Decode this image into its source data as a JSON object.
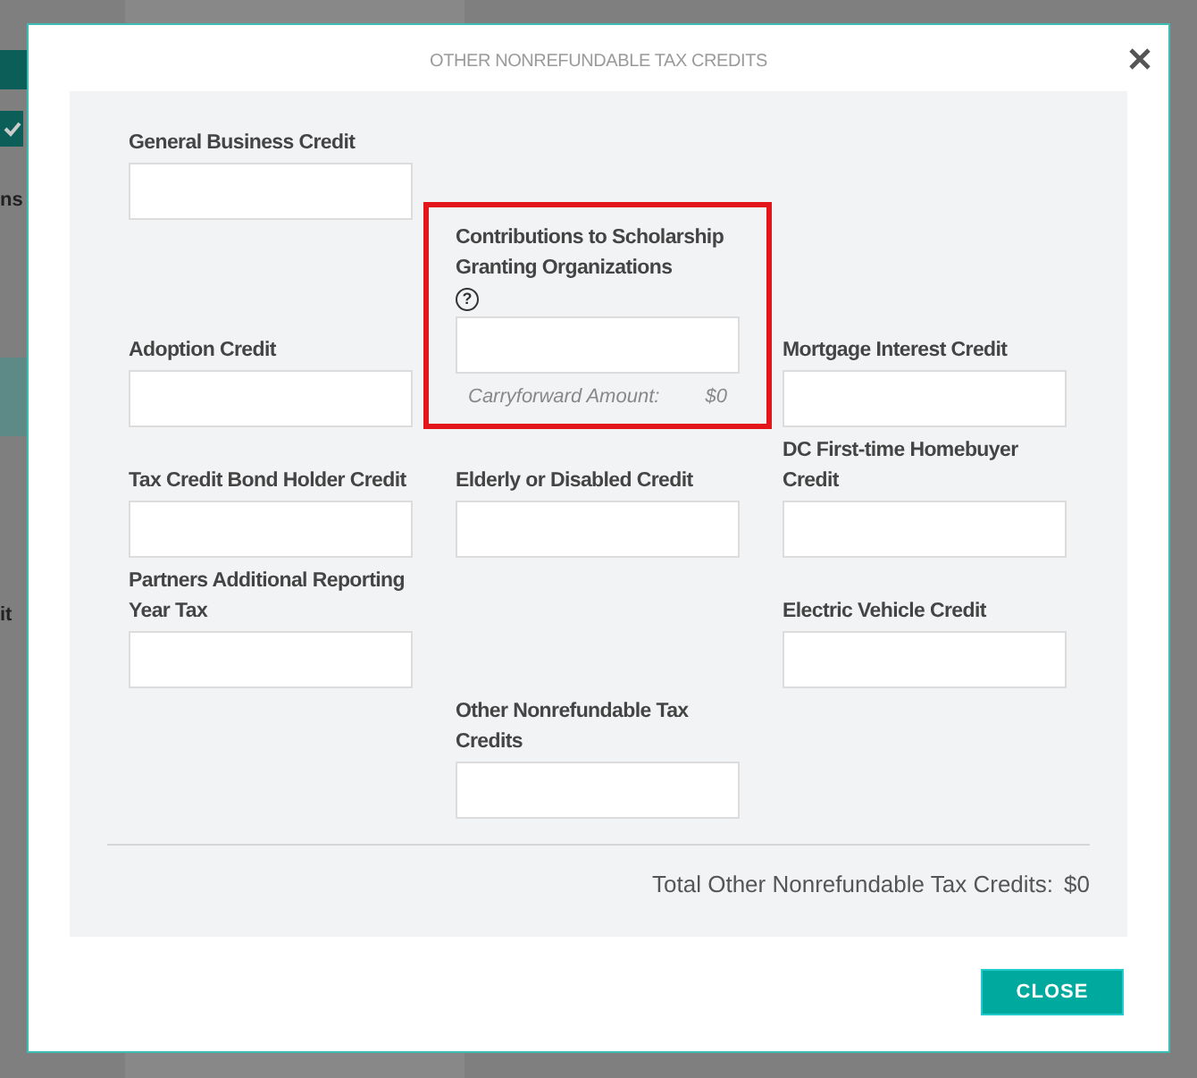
{
  "background": {
    "fragments": [
      {
        "kind": "header"
      },
      {
        "kind": "check",
        "checked": true
      },
      {
        "kind": "label",
        "text": "ns"
      },
      {
        "kind": "band"
      },
      {
        "kind": "label",
        "text": "it"
      }
    ]
  },
  "dialog": {
    "title": "OTHER NONREFUNDABLE TAX CREDITS",
    "fields": [
      {
        "label": "General Business Credit",
        "highlighted": false
      },
      {
        "label": "Contributions to Scholarship Granting Organizations",
        "help": "?",
        "highlighted": true,
        "carryforward": {
          "label": "Carryforward Amount:",
          "value": "$0"
        }
      },
      {
        "label": "Adoption Credit",
        "highlighted": false
      },
      {
        "label": "Mortgage Interest Credit",
        "highlighted": false
      },
      {
        "label": "Tax Credit Bond Holder Credit",
        "highlighted": false
      },
      {
        "label": "Elderly or Disabled Credit",
        "highlighted": false
      },
      {
        "label": "DC First-time Homebuyer Credit",
        "highlighted": false
      },
      {
        "label": "Partners Additional Reporting Year Tax",
        "highlighted": false
      },
      {
        "label": "Electric Vehicle Credit",
        "highlighted": false
      },
      {
        "label": "Other Nonrefundable Tax Credits",
        "highlighted": false
      }
    ],
    "total": {
      "label": "Total Other Nonrefundable Tax Credits:",
      "value": "$0"
    },
    "buttons": [
      "CLOSE"
    ]
  }
}
